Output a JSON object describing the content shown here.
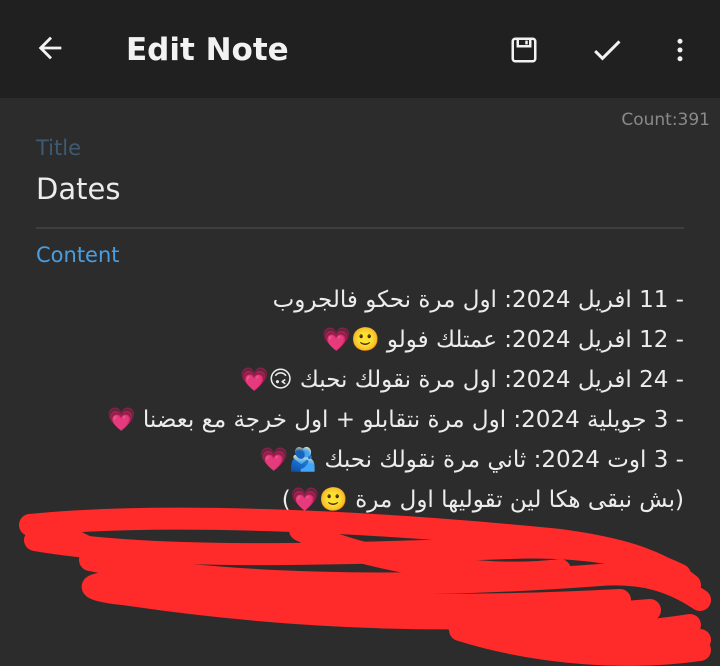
{
  "appbar": {
    "title": "Edit Note"
  },
  "count_label": "Count:391",
  "note": {
    "title_label": "Title",
    "title_value": "Dates",
    "content_label": "Content",
    "lines": [
      "- 11 افريل 2024: اول مرة نحكو فالجروب",
      "- 12 افريل 2024: عمتلك فولو 🙂💗",
      "- 24 افريل 2024: اول مرة نقولك نحبك 🙃💗",
      "- 3 جويلية 2024: اول مرة نتقابلو + اول خرجة مع بعضنا 💗",
      "- 3 اوت 2024: ثاني مرة نقولك نحبك 🫂💗",
      "(بش نبقى هكا لين تقوليها اول مرة 🙂💗)"
    ]
  },
  "icons": {
    "back": "arrow-left-icon",
    "save": "save-icon",
    "confirm": "check-icon",
    "more": "more-vertical-icon"
  },
  "colors": {
    "appbar": "#202020",
    "background": "#2c2c2c",
    "accent": "#4a9ee0",
    "scribble": "#ff2a2a"
  }
}
